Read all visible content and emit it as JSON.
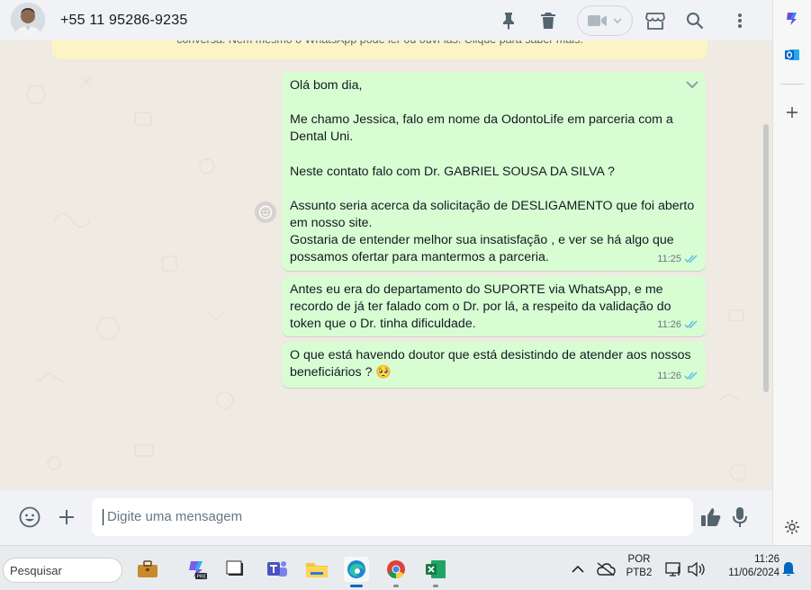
{
  "header": {
    "contact_name": "+55 11 95286-9235"
  },
  "banner": {
    "text": "conversa. Nem mesmo o WhatsApp pode ler ou ouvi-las. Clique para saber mais."
  },
  "messages": [
    {
      "lines": [
        "Olá bom dia,",
        "",
        "Me chamo Jessica, falo em nome da OdontoLife em parceria com a",
        "Dental Uni.",
        "",
        "Neste contato falo com Dr. GABRIEL SOUSA DA SILVA ?",
        "",
        "Assunto seria acerca da solicitação de DESLIGAMENTO que foi aberto",
        "em nosso site.",
        "Gostaria de entender melhor sua insatisfação , e ver se há algo que",
        "possamos ofertar para mantermos a parceria."
      ],
      "time": "11:25"
    },
    {
      "lines": [
        "Antes eu era do departamento do SUPORTE via WhatsApp, e me",
        "recordo de já ter falado com o Dr. por lá, a respeito da validação do",
        "token que o Dr. tinha dificuldade."
      ],
      "time": "11:26"
    },
    {
      "lines": [
        "O que está havendo doutor que está desistindo de atender aos nossos",
        "beneficiários ? 🥺"
      ],
      "time": "11:26"
    }
  ],
  "composer": {
    "placeholder": "Digite uma mensagem"
  },
  "taskbar": {
    "search_placeholder": "Pesquisar",
    "language": "POR",
    "layout": "PTB2",
    "time": "11:26",
    "date": "11/06/2024"
  },
  "colors": {
    "bubble_out": "#d9fdd3",
    "chat_bg": "#efeae2",
    "read_ticks": "#53bdeb",
    "banner": "#fdf4c5"
  },
  "icons": {
    "header": [
      "pin-icon",
      "trash-icon",
      "video-call-icon",
      "store-icon",
      "search-icon",
      "menu-icon"
    ],
    "composer": [
      "emoji-icon",
      "attach-plus-icon",
      "thumbs-up-icon",
      "microphone-icon"
    ],
    "sidepanel": [
      "copilot-icon",
      "outlook-icon",
      "add-icon",
      "settings-icon"
    ]
  }
}
